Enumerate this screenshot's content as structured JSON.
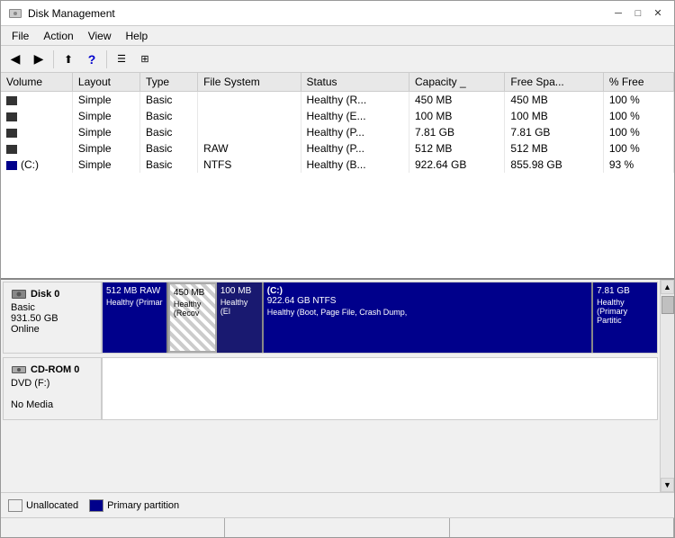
{
  "window": {
    "title": "Disk Management",
    "controls": {
      "minimize": "─",
      "maximize": "□",
      "close": "✕"
    }
  },
  "menu": {
    "items": [
      "File",
      "Action",
      "View",
      "Help"
    ]
  },
  "toolbar": {
    "buttons": [
      "◀",
      "▶",
      "⊞",
      "?",
      "⊟",
      "⊡"
    ]
  },
  "table": {
    "columns": [
      "Volume",
      "Layout",
      "Type",
      "File System",
      "Status",
      "Capacity",
      "Free Spa...",
      "% Free"
    ],
    "rows": [
      {
        "volume": "",
        "layout": "Simple",
        "type": "Basic",
        "filesystem": "",
        "status": "Healthy (R...",
        "capacity": "450 MB",
        "free": "450 MB",
        "pct": "100 %"
      },
      {
        "volume": "",
        "layout": "Simple",
        "type": "Basic",
        "filesystem": "",
        "status": "Healthy (E...",
        "capacity": "100 MB",
        "free": "100 MB",
        "pct": "100 %"
      },
      {
        "volume": "",
        "layout": "Simple",
        "type": "Basic",
        "filesystem": "",
        "status": "Healthy (P...",
        "capacity": "7.81 GB",
        "free": "7.81 GB",
        "pct": "100 %"
      },
      {
        "volume": "",
        "layout": "Simple",
        "type": "Basic",
        "filesystem": "RAW",
        "status": "Healthy (P...",
        "capacity": "512 MB",
        "free": "512 MB",
        "pct": "100 %"
      },
      {
        "volume": "(C:)",
        "layout": "Simple",
        "type": "Basic",
        "filesystem": "NTFS",
        "status": "Healthy (B...",
        "capacity": "922.64 GB",
        "free": "855.98 GB",
        "pct": "93 %"
      }
    ]
  },
  "disks": {
    "disk0": {
      "name": "Disk 0",
      "type": "Basic",
      "size": "931.50 GB",
      "status": "Online",
      "partitions": [
        {
          "id": "p1",
          "size": "512 MB RAW",
          "desc": "Healthy (Primar",
          "style": "blue",
          "flex": 3
        },
        {
          "id": "p2",
          "size": "450 MB",
          "desc": "Healthy (Recov",
          "style": "hatched",
          "flex": 2
        },
        {
          "id": "p3",
          "size": "100 MB",
          "desc": "Healthy (El",
          "style": "dark",
          "flex": 2
        },
        {
          "id": "p4",
          "name": "(C:)",
          "size": "922.64 GB NTFS",
          "desc": "Healthy (Boot, Page File, Crash Dump,",
          "style": "blue2",
          "flex": 17
        },
        {
          "id": "p5",
          "size": "7.81 GB",
          "desc": "Healthy (Primary Partitic",
          "style": "blue3",
          "flex": 3
        }
      ]
    },
    "cdrom0": {
      "name": "CD-ROM 0",
      "drive": "DVD (F:)",
      "media": "No Media"
    }
  },
  "legend": {
    "items": [
      {
        "label": "Unallocated",
        "style": "unalloc"
      },
      {
        "label": "Primary partition",
        "style": "primary"
      }
    ]
  },
  "statusbar": {
    "segments": [
      "",
      "",
      ""
    ]
  }
}
